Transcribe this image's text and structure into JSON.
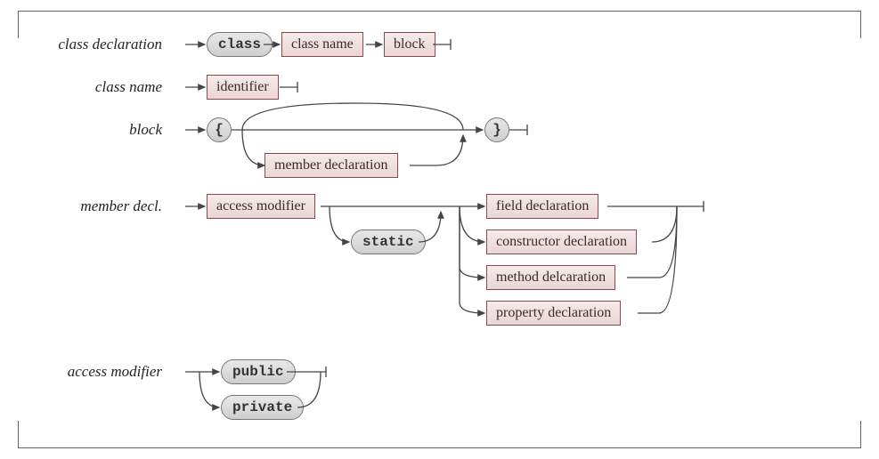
{
  "rules": {
    "class_declaration": {
      "label": "class declaration",
      "sequence": [
        "class",
        "class name",
        "block"
      ],
      "node_types": [
        "terminal",
        "nonterminal",
        "nonterminal"
      ]
    },
    "class_name": {
      "label": "class name",
      "sequence": [
        "identifier"
      ],
      "node_types": [
        "nonterminal"
      ]
    },
    "block": {
      "label": "block",
      "open": "{",
      "close": "}",
      "loop_body": "member declaration",
      "loop_min": 0
    },
    "member_decl": {
      "label": "member decl.",
      "prefix": "access modifier",
      "optional": "static",
      "alternatives": [
        "field declaration",
        "constructor declaration",
        "method delcaration",
        "property declaration"
      ]
    },
    "access_modifier": {
      "label": "access modifier",
      "alternatives": [
        "public",
        "private"
      ],
      "node_types": [
        "terminal",
        "terminal"
      ]
    }
  },
  "colors": {
    "terminal_fill": "#dcdcdc",
    "terminal_border": "#777777",
    "nonterminal_fill": "#ead6d6",
    "nonterminal_border": "#8a4a4a",
    "rail": "#444444"
  }
}
